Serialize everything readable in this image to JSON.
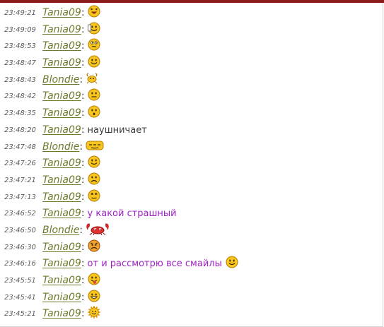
{
  "messages": [
    {
      "time": "23:49:21",
      "nick": "Tania09",
      "text": "",
      "smiley": "laughing-smiley-icon",
      "style": "black"
    },
    {
      "time": "23:49:09",
      "nick": "Tania09",
      "text": "",
      "smiley": "phone-smiley-icon",
      "style": "black"
    },
    {
      "time": "23:48:53",
      "nick": "Tania09",
      "text": "",
      "smiley": "thinking-smiley-icon",
      "style": "black"
    },
    {
      "time": "23:48:47",
      "nick": "Tania09",
      "text": "",
      "smiley": "smile-icon",
      "style": "black"
    },
    {
      "time": "23:48:43",
      "nick": "Blondie",
      "text": "",
      "smiley": "crab-smiley-icon",
      "style": "black"
    },
    {
      "time": "23:48:42",
      "nick": "Tania09",
      "text": "",
      "smiley": "neutral-smiley-icon",
      "style": "black"
    },
    {
      "time": "23:48:35",
      "nick": "Tania09",
      "text": "",
      "smiley": "surprised-smiley-icon",
      "style": "black"
    },
    {
      "time": "23:48:20",
      "nick": "Tania09",
      "text": "наушничает",
      "smiley": "",
      "style": "black"
    },
    {
      "time": "23:47:48",
      "nick": "Blondie",
      "text": "",
      "smiley": "sleepy-smiley-icon",
      "style": "black"
    },
    {
      "time": "23:47:26",
      "nick": "Tania09",
      "text": "",
      "smiley": "smile-icon",
      "style": "black"
    },
    {
      "time": "23:47:21",
      "nick": "Tania09",
      "text": "",
      "smiley": "sad-smiley-icon",
      "style": "black"
    },
    {
      "time": "23:47:13",
      "nick": "Tania09",
      "text": "",
      "smiley": "rolleyes-smiley-icon",
      "style": "black"
    },
    {
      "time": "23:46:52",
      "nick": "Tania09",
      "text": "у какой страшный",
      "smiley": "",
      "style": "purple"
    },
    {
      "time": "23:46:50",
      "nick": "Blondie",
      "text": "",
      "smiley": "crab-red-smiley-icon",
      "style": "black"
    },
    {
      "time": "23:46:30",
      "nick": "Tania09",
      "text": "",
      "smiley": "angry-smiley-icon",
      "style": "black"
    },
    {
      "time": "23:46:16",
      "nick": "Tania09",
      "text": "от и рассмотрю все смайлы",
      "smiley": "smile-icon",
      "style": "purple"
    },
    {
      "time": "23:45:51",
      "nick": "Tania09",
      "text": "",
      "smiley": "tongue-smiley-icon",
      "style": "black"
    },
    {
      "time": "23:45:41",
      "nick": "Tania09",
      "text": "",
      "smiley": "grin-smiley-icon",
      "style": "black"
    },
    {
      "time": "23:45:21",
      "nick": "Tania09",
      "text": "",
      "smiley": "sun-smiley-icon",
      "style": "black"
    }
  ],
  "colon": ":",
  "colors": {
    "nick": "#6e7a2c",
    "purple_text": "#a020c8",
    "time": "#5a5a5a",
    "smiley_face": "#f7c51d",
    "top_bar": "#8b1a1a"
  }
}
